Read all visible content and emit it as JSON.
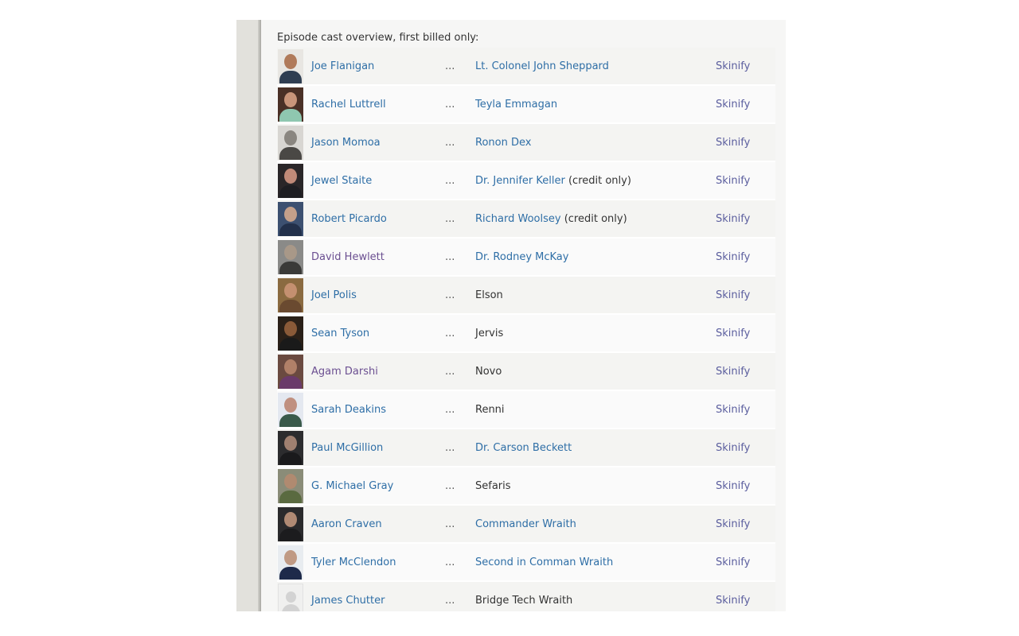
{
  "heading": "Episode cast overview, first billed only:",
  "ellipsis": "...",
  "cast": [
    {
      "actor": "Joe Flanigan",
      "visited": false,
      "character": "Lt. Colonel John Sheppard",
      "character_link": true,
      "note": "",
      "action": "Skinify",
      "photo": {
        "skin": "#b07a5a",
        "shirt": "#2f3e52",
        "bg": "#e8e6e2"
      }
    },
    {
      "actor": "Rachel Luttrell",
      "visited": false,
      "character": "Teyla Emmagan",
      "character_link": true,
      "note": "",
      "action": "Skinify",
      "photo": {
        "skin": "#c9957a",
        "shirt": "#8fc7b0",
        "bg": "#4a3026"
      }
    },
    {
      "actor": "Jason Momoa",
      "visited": false,
      "character": "Ronon Dex",
      "character_link": true,
      "note": "",
      "action": "Skinify",
      "photo": {
        "skin": "#8a8680",
        "shirt": "#4a4845",
        "bg": "#d8d6d2"
      }
    },
    {
      "actor": "Jewel Staite",
      "visited": false,
      "character": "Dr. Jennifer Keller",
      "character_link": true,
      "note": "(credit only)",
      "action": "Skinify",
      "photo": {
        "skin": "#c08a78",
        "shirt": "#1e1e22",
        "bg": "#2a2628"
      }
    },
    {
      "actor": "Robert Picardo",
      "visited": false,
      "character": "Richard Woolsey",
      "character_link": true,
      "note": "(credit only)",
      "action": "Skinify",
      "photo": {
        "skin": "#c4a08a",
        "shirt": "#22304a",
        "bg": "#3c5070"
      }
    },
    {
      "actor": "David Hewlett",
      "visited": true,
      "character": "Dr. Rodney McKay",
      "character_link": true,
      "note": "",
      "action": "Skinify",
      "photo": {
        "skin": "#a89888",
        "shirt": "#3a3a38",
        "bg": "#8a8a88"
      }
    },
    {
      "actor": "Joel Polis",
      "visited": false,
      "character": "Elson",
      "character_link": false,
      "note": "",
      "action": "Skinify",
      "photo": {
        "skin": "#c49070",
        "shirt": "#6a4a30",
        "bg": "#8a6a40"
      }
    },
    {
      "actor": "Sean Tyson",
      "visited": false,
      "character": "Jervis",
      "character_link": false,
      "note": "",
      "action": "Skinify",
      "photo": {
        "skin": "#8a5a38",
        "shirt": "#1a1a1a",
        "bg": "#2a2018"
      }
    },
    {
      "actor": "Agam Darshi",
      "visited": true,
      "character": "Novo",
      "character_link": false,
      "note": "",
      "action": "Skinify",
      "photo": {
        "skin": "#b08068",
        "shirt": "#6a3a6a",
        "bg": "#6a4a40"
      }
    },
    {
      "actor": "Sarah Deakins",
      "visited": false,
      "character": "Renni",
      "character_link": false,
      "note": "",
      "action": "Skinify",
      "photo": {
        "skin": "#c09080",
        "shirt": "#3a5a4a",
        "bg": "#e4e8f0"
      }
    },
    {
      "actor": "Paul McGillion",
      "visited": false,
      "character": "Dr. Carson Beckett",
      "character_link": true,
      "note": "",
      "action": "Skinify",
      "photo": {
        "skin": "#a08070",
        "shirt": "#1a1a1c",
        "bg": "#2c2c2e"
      }
    },
    {
      "actor": "G. Michael Gray",
      "visited": false,
      "character": "Sefaris",
      "character_link": false,
      "note": "",
      "action": "Skinify",
      "photo": {
        "skin": "#b08a70",
        "shirt": "#5a6a40",
        "bg": "#8a8c78"
      }
    },
    {
      "actor": "Aaron Craven",
      "visited": false,
      "character": "Commander Wraith",
      "character_link": true,
      "note": "",
      "action": "Skinify",
      "photo": {
        "skin": "#b08a74",
        "shirt": "#1c1c1e",
        "bg": "#2a2a2c"
      }
    },
    {
      "actor": "Tyler McClendon",
      "visited": false,
      "character": "Second in Comman Wraith",
      "character_link": true,
      "note": "",
      "action": "Skinify",
      "photo": {
        "skin": "#c09a84",
        "shirt": "#1e2a4a",
        "bg": "#e8ecf0"
      }
    },
    {
      "actor": "James Chutter",
      "visited": false,
      "character": "Bridge Tech Wraith",
      "character_link": false,
      "note": "",
      "action": "Skinify",
      "photo": null
    }
  ]
}
